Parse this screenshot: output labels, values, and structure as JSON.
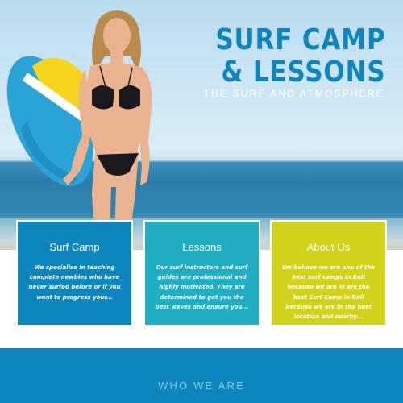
{
  "hero": {
    "title_line1": "SURF CAMP",
    "title_line2": "& LESSONS",
    "subtitle": "THE SURF AND ATMOSPHERE"
  },
  "cards": [
    {
      "title": "Surf Camp",
      "text": "We specialise in teaching complete newbies who have never surfed before or if you want to progress your...",
      "color": "#0d86bd"
    },
    {
      "title": "Lessons",
      "text": "Our surf instructors and surf guides are professional and highly motivated. They are determined to get you the best waves and ensure you...",
      "color": "#20aec2"
    },
    {
      "title": "About Us",
      "text": "We believe we are one of the best surf camps in Bali because we are in are the best Surf Camp in Bali because we are in the best location and nearby...",
      "color": "#d1d31a"
    }
  ],
  "section": {
    "title": "WHO WE ARE"
  },
  "colors": {
    "brand_blue": "#0d86bd",
    "teal": "#20aec2",
    "lime": "#d1d31a"
  }
}
